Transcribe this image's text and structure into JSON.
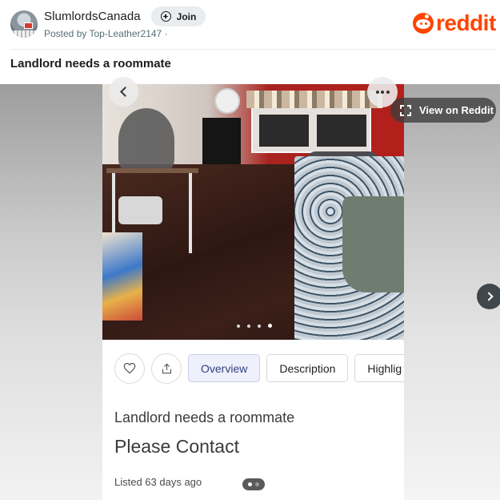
{
  "header": {
    "subreddit": "SlumlordsCanada",
    "join_label": "Join",
    "posted_by": "Posted by Top-Leather2147 ·",
    "brand_word": "reddit",
    "brand_color": "#ff4500"
  },
  "post": {
    "title": "Landlord needs a roommate ",
    "view_on_reddit": "View on Reddit"
  },
  "listing": {
    "tabs": [
      {
        "label": "Overview",
        "active": true
      },
      {
        "label": "Description",
        "active": false
      },
      {
        "label": "Highlig",
        "active": false
      }
    ],
    "heading": "Landlord needs a roommate",
    "price": "Please Contact",
    "listed": "Listed 63 days ago",
    "photo_count": 4,
    "photo_active_index": 3
  },
  "icons": {
    "like": "heart-icon",
    "share": "share-icon",
    "prev": "chevron-left-icon",
    "more": "more-icon",
    "expand": "expand-icon",
    "next": "chevron-right-icon"
  }
}
